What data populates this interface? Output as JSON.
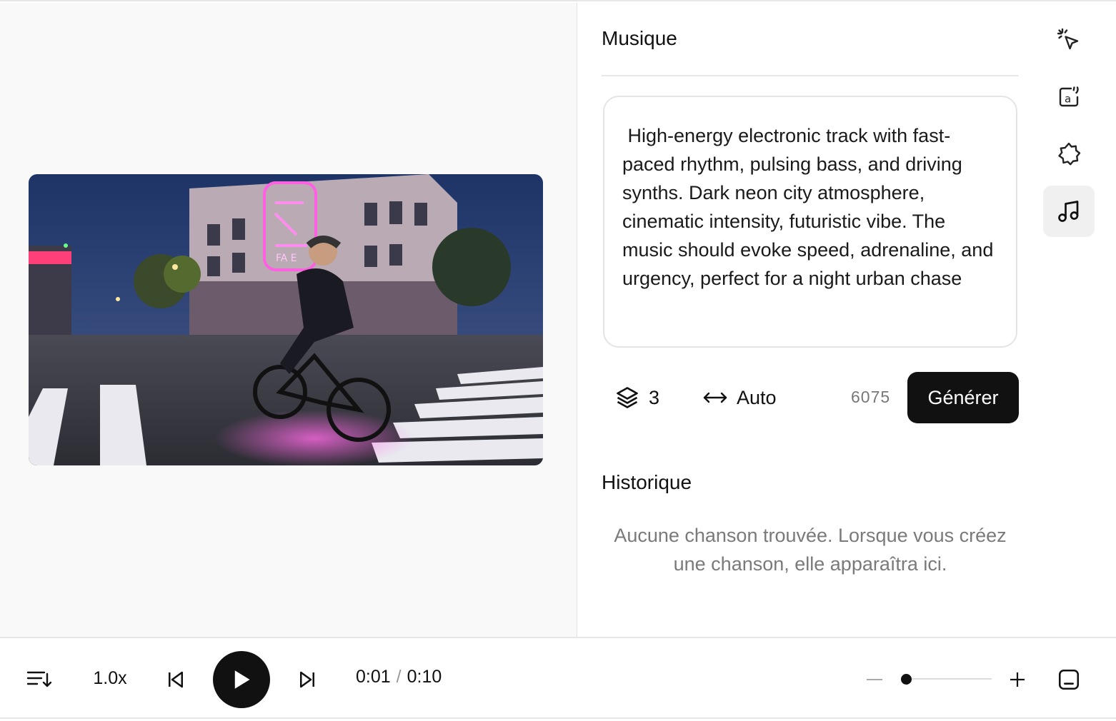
{
  "panel": {
    "title": "Musique",
    "prompt": " High-energy electronic track with fast-paced rhythm, pulsing bass, and driving synths. Dark neon city atmosphere, cinematic intensity, futuristic vibe. The music should evoke speed, adrenaline, and urgency, perfect for a night urban chase",
    "variants_count": "3",
    "duration": "Auto",
    "credits": "6075",
    "generate_label": "Générer",
    "history_title": "Historique",
    "history_empty": "Aucune chanson trouvée. Lorsque vous créez une chanson, elle apparaîtra ici."
  },
  "tools": [
    "cursor-sparkle-icon",
    "translate-icon",
    "badge-star-icon",
    "music-note-icon"
  ],
  "playback": {
    "speed": "1.0x",
    "current_time": "0:01",
    "separator": "/",
    "total_time": "0:10",
    "zoom_level": 0.05
  },
  "video": {
    "neon_sign_text": "FA E"
  },
  "colors": {
    "accent": "#111111",
    "muted_text": "#7a7a7a",
    "active_tool_bg": "#f0f0f0",
    "neon": "#ff4fd8"
  }
}
